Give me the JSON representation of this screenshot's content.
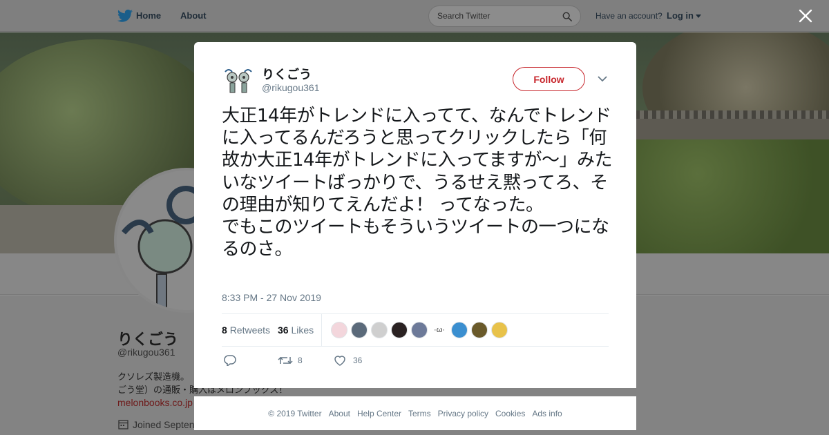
{
  "nav": {
    "home_label": "Home",
    "about_label": "About",
    "search_placeholder": "Search Twitter",
    "have_account": "Have an account?",
    "login_label": "Log in"
  },
  "profile": {
    "name": "りくごう",
    "handle": "@rikugou361",
    "bio_line1": "クソレズ製造機。",
    "bio_line2": "ごう堂）の通販・購入はメロンブックス！",
    "link": "melonbooks.co.jp",
    "joined": "Joined Septen"
  },
  "tweet": {
    "author_name": "りくごう",
    "author_handle": "@rikugou361",
    "follow_label": "Follow",
    "text": "大正14年がトレンドに入ってて、なんでトレンドに入ってるんだろうと思ってクリックしたら「何故か大正14年がトレンドに入ってますが～」みたいなツイートばっかりで、うるせえ黙ってろ、その理由が知りてえんだよ！ ってなった。\nでもこのツイートもそういうツイートの一つになるのさ。",
    "timestamp": "8:33 PM - 27 Nov 2019",
    "retweets_count": "8",
    "retweets_label": "Retweets",
    "likes_count": "36",
    "likes_label": "Likes",
    "retweet_action_count": "8",
    "like_action_count": "36",
    "liker_kaomoji": "·ω·"
  },
  "likers": [
    {
      "color": "#f3d6dc"
    },
    {
      "color": "#5b6a7a"
    },
    {
      "color": "#cfcfcf"
    },
    {
      "color": "#2a2222"
    },
    {
      "color": "#6d7a99"
    },
    {
      "color": "#ffffff"
    },
    {
      "color": "#3b8fd0"
    },
    {
      "color": "#6a5a2a"
    },
    {
      "color": "#e8c24a"
    }
  ],
  "footer": {
    "links": [
      "© 2019 Twitter",
      "About",
      "Help Center",
      "Terms",
      "Privacy policy",
      "Cookies",
      "Ads info"
    ]
  },
  "colors": {
    "brand_accent": "#c7252b",
    "twitter_blue": "#1da1f2",
    "meta_gray": "#657786"
  },
  "icons": [
    "twitter-bird-icon",
    "search-icon",
    "close-icon",
    "chevron-down-icon",
    "reply-icon",
    "retweet-icon",
    "heart-icon",
    "calendar-icon"
  ]
}
